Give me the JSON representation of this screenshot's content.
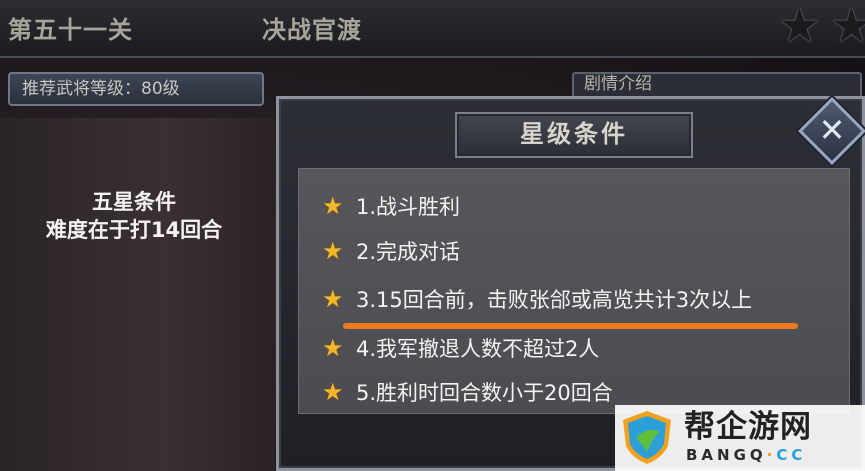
{
  "header": {
    "level_title": "第五十一关",
    "stage_name": "决战官渡",
    "star_rating_icons": [
      "star-icon",
      "star-icon"
    ]
  },
  "recommend": {
    "label": "推荐武将等级：80级"
  },
  "story_tab": {
    "label": "剧情介绍"
  },
  "note": {
    "line1": "五星条件",
    "line2": "难度在于打14回合"
  },
  "dialog": {
    "title": "星级条件",
    "close_icon": "close-icon",
    "conditions": [
      "1.战斗胜利",
      "2.完成对话",
      "3.15回合前，击败张郃或高览共计3次以上",
      "4.我军撤退人数不超过2人",
      "5.胜利时回合数小于20回合"
    ],
    "condition_icon": "star-icon",
    "highlight_color": "#ee7a1f"
  },
  "watermark": {
    "brand": "帮企游网",
    "domain_main": "BANGQ",
    "domain_sep": "·",
    "domain_tld": "CC"
  }
}
